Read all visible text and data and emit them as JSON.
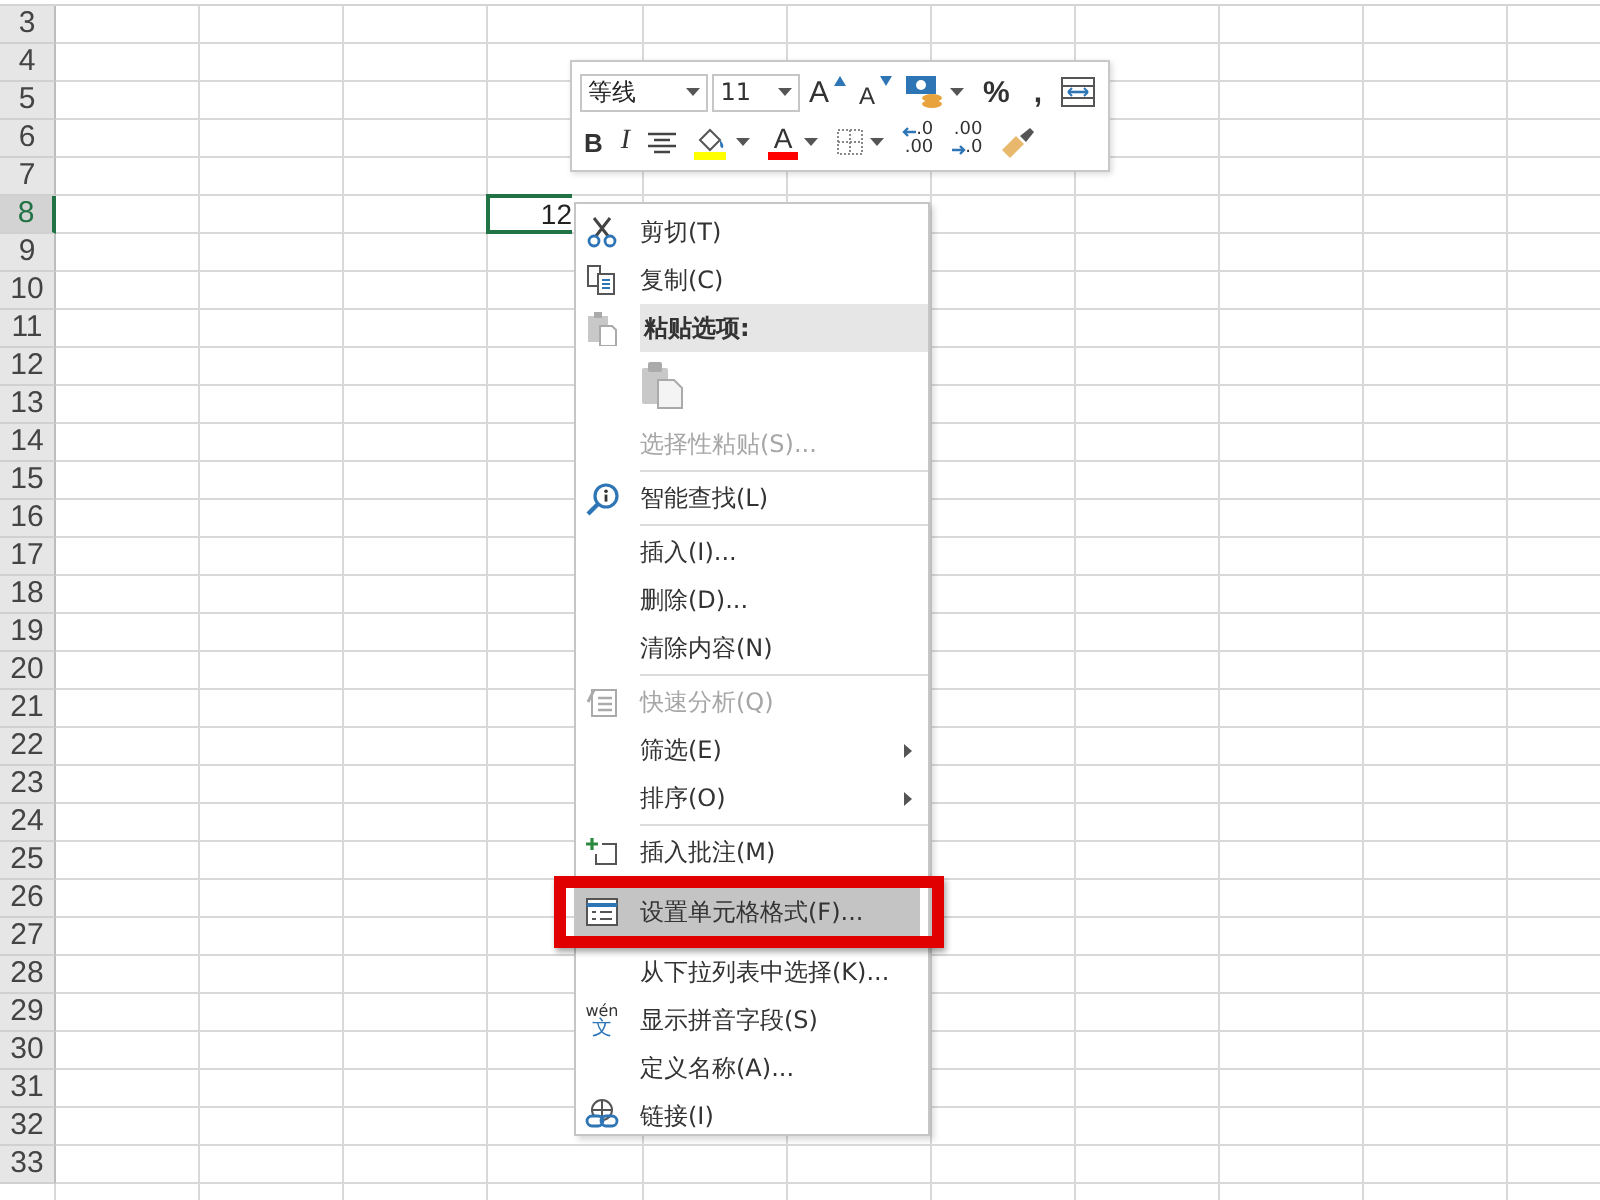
{
  "sheet": {
    "rows": [
      {
        "label": "3",
        "selected": false
      },
      {
        "label": "4",
        "selected": false
      },
      {
        "label": "5",
        "selected": false
      },
      {
        "label": "6",
        "selected": false
      },
      {
        "label": "7",
        "selected": false
      },
      {
        "label": "8",
        "selected": true
      },
      {
        "label": "9",
        "selected": false
      },
      {
        "label": "10",
        "selected": false
      },
      {
        "label": "11",
        "selected": false
      },
      {
        "label": "12",
        "selected": false
      },
      {
        "label": "13",
        "selected": false
      },
      {
        "label": "14",
        "selected": false
      },
      {
        "label": "15",
        "selected": false
      },
      {
        "label": "16",
        "selected": false
      },
      {
        "label": "17",
        "selected": false
      },
      {
        "label": "18",
        "selected": false
      },
      {
        "label": "19",
        "selected": false
      },
      {
        "label": "20",
        "selected": false
      },
      {
        "label": "21",
        "selected": false
      },
      {
        "label": "22",
        "selected": false
      },
      {
        "label": "23",
        "selected": false
      },
      {
        "label": "24",
        "selected": false
      },
      {
        "label": "25",
        "selected": false
      },
      {
        "label": "26",
        "selected": false
      },
      {
        "label": "27",
        "selected": false
      },
      {
        "label": "28",
        "selected": false
      },
      {
        "label": "29",
        "selected": false
      },
      {
        "label": "30",
        "selected": false
      },
      {
        "label": "31",
        "selected": false
      },
      {
        "label": "32",
        "selected": false
      },
      {
        "label": "33",
        "selected": false
      }
    ],
    "active_cell": {
      "value": "12"
    }
  },
  "mini_toolbar": {
    "font": "等线",
    "size": "11",
    "row_1": [
      {
        "kind": "grow",
        "label": "A"
      },
      {
        "kind": "shrink",
        "label": "A"
      },
      {
        "kind": "accounting"
      },
      {
        "kind": "char",
        "label": "%"
      },
      {
        "kind": "char",
        "label": ","
      },
      {
        "kind": "merge"
      }
    ],
    "row_2": [
      {
        "kind": "bold",
        "label": "B"
      },
      {
        "kind": "italic",
        "label": "I"
      },
      {
        "kind": "align"
      },
      {
        "kind": "fill",
        "color": "#ffff00"
      },
      {
        "kind": "fontcolor",
        "label": "A",
        "color": "#ff0000"
      },
      {
        "kind": "borders"
      },
      {
        "kind": "incdec",
        "lines": [
          ".0",
          ".00"
        ]
      },
      {
        "kind": "decdec",
        "lines": [
          ".00",
          ".0"
        ]
      },
      {
        "kind": "painter"
      }
    ]
  },
  "context_menu": [
    {
      "kind": "item",
      "label": "剪切(T)",
      "disabled": false,
      "selected": false
    },
    {
      "kind": "item",
      "label": "复制(C)",
      "disabled": false,
      "selected": false
    },
    {
      "kind": "header",
      "label": "粘贴选项:"
    },
    {
      "kind": "paste"
    },
    {
      "kind": "item",
      "label": "选择性粘贴(S)...",
      "disabled": true,
      "selected": false
    },
    {
      "kind": "separator"
    },
    {
      "kind": "item",
      "label": "智能查找(L)",
      "disabled": false,
      "selected": false
    },
    {
      "kind": "separator"
    },
    {
      "kind": "item",
      "label": "插入(I)...",
      "disabled": false,
      "selected": false
    },
    {
      "kind": "item",
      "label": "删除(D)...",
      "disabled": false,
      "selected": false
    },
    {
      "kind": "item",
      "label": "清除内容(N)",
      "disabled": false,
      "selected": false
    },
    {
      "kind": "separator"
    },
    {
      "kind": "item",
      "label": "快速分析(Q)",
      "disabled": true,
      "selected": false
    },
    {
      "kind": "item",
      "label": "筛选(E)",
      "disabled": false,
      "selected": false,
      "submenu": true
    },
    {
      "kind": "item",
      "label": "排序(O)",
      "disabled": false,
      "selected": false,
      "submenu": true
    },
    {
      "kind": "separator"
    },
    {
      "kind": "item",
      "label": "插入批注(M)",
      "disabled": false,
      "selected": false
    },
    {
      "kind": "item",
      "label": "设置单元格格式(F)...",
      "disabled": false,
      "selected": true,
      "annotated": true
    },
    {
      "kind": "item",
      "label": "从下拉列表中选择(K)...",
      "disabled": false,
      "selected": false
    },
    {
      "kind": "item",
      "label": "显示拼音字段(S)",
      "disabled": false,
      "selected": false,
      "icon_glyphs": [
        "wén",
        "文"
      ]
    },
    {
      "kind": "item",
      "label": "定义名称(A)...",
      "disabled": false,
      "selected": false
    },
    {
      "kind": "item",
      "label": "链接(I)",
      "disabled": false,
      "selected": false
    }
  ]
}
